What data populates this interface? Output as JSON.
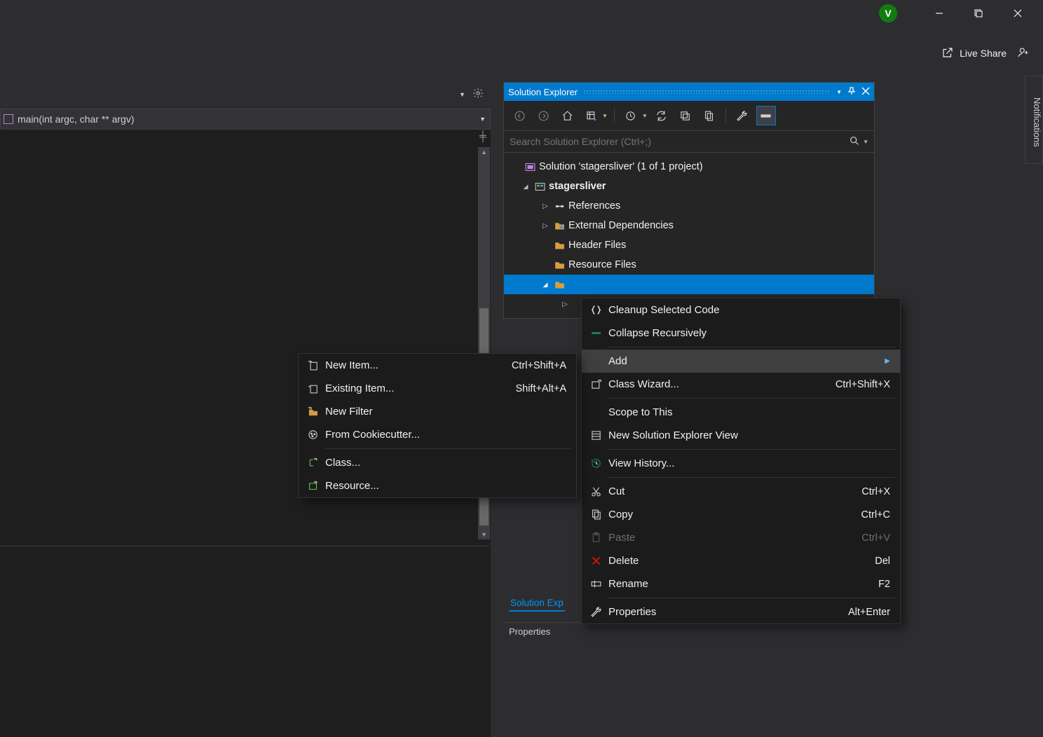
{
  "titlebar": {
    "avatar_initial": "V"
  },
  "toolrow2": {
    "live_share": "Live Share"
  },
  "editor": {
    "combo_text": "main(int argc, char ** argv)"
  },
  "solution_explorer": {
    "title": "Solution Explorer",
    "search_placeholder": "Search Solution Explorer (Ctrl+;)",
    "tree": {
      "solution": "Solution 'stagersliver' (1 of 1 project)",
      "project": "stagersliver",
      "refs": "References",
      "extdeps": "External Dependencies",
      "headers": "Header Files",
      "resources": "Resource Files"
    },
    "tab_label": "Solution Exp",
    "properties_title": "Properties"
  },
  "notifications_tab": "Notifications",
  "context_main": {
    "cleanup": "Cleanup Selected Code",
    "collapse": "Collapse Recursively",
    "add": "Add",
    "classwiz": "Class Wizard...",
    "classwiz_sc": "Ctrl+Shift+X",
    "scope": "Scope to This",
    "newview": "New Solution Explorer View",
    "history": "View History...",
    "cut": "Cut",
    "cut_sc": "Ctrl+X",
    "copy": "Copy",
    "copy_sc": "Ctrl+C",
    "paste": "Paste",
    "paste_sc": "Ctrl+V",
    "delete": "Delete",
    "delete_sc": "Del",
    "rename": "Rename",
    "rename_sc": "F2",
    "props": "Properties",
    "props_sc": "Alt+Enter"
  },
  "context_add": {
    "newitem": "New Item...",
    "newitem_sc": "Ctrl+Shift+A",
    "existing": "Existing Item...",
    "existing_sc": "Shift+Alt+A",
    "newfilter": "New Filter",
    "cookie": "From Cookiecutter...",
    "class": "Class...",
    "resource": "Resource..."
  }
}
